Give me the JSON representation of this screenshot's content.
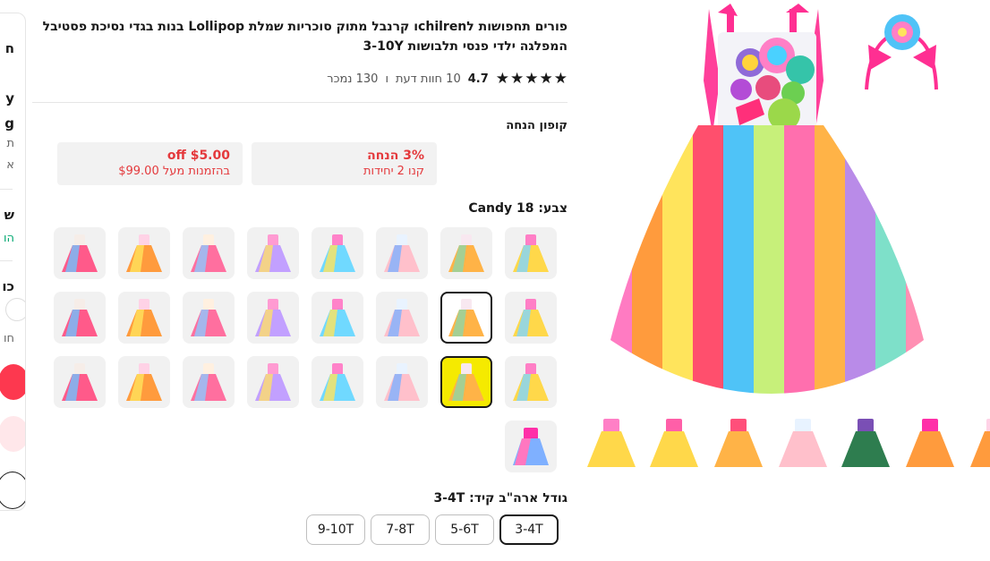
{
  "side_panel": {
    "row1": "ח",
    "row2": "y",
    "row3": "g",
    "row4": "ת",
    "row5": "א",
    "row6": "ש",
    "row7": "הו",
    "row8": "כו",
    "row9": "חו"
  },
  "product": {
    "title": "פורים תחפושות לchilrenו קרנבל מתוק סוכריות שמלת Lollipop בנות בגדי נסיכת פסטיבל המפלגה ילדי פנסי תלבושות 3-10Y",
    "rating": "4.7",
    "reviews": "10 חוות דעת",
    "separator": "ו",
    "sold": "130 נמכר"
  },
  "coupons": {
    "title": "קופון הנחה",
    "items": [
      {
        "big": "3% הנחה",
        "small": "קנו 2 יחידות"
      },
      {
        "big": "$5.00 off",
        "small": "בהזמנות מעל $99.00"
      }
    ]
  },
  "color": {
    "label": "צבע: Candy 18"
  },
  "size": {
    "label": "גודל ארה\"ב קיד: 3-4T",
    "options": [
      "3-4T",
      "5-6T",
      "7-8T",
      "9-10T"
    ],
    "selected": "3-4T"
  },
  "colors_palette": {
    "dark": "#191919",
    "price_red": "#e4393c",
    "coupon_bg": "#f2f2f2",
    "highlight": "#f5ea00"
  }
}
